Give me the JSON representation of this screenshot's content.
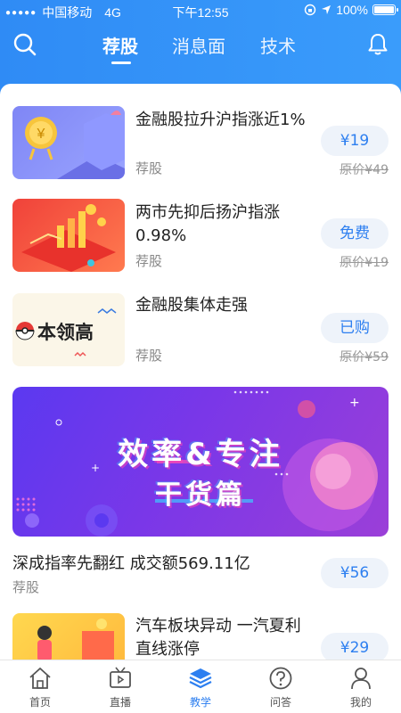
{
  "status_bar": {
    "carrier": "中国移动",
    "network": "4G",
    "time": "下午12:55",
    "battery": "100%"
  },
  "nav": {
    "tabs": [
      {
        "label": "荐股",
        "active": true
      },
      {
        "label": "消息面",
        "active": false
      },
      {
        "label": "技术",
        "active": false
      }
    ]
  },
  "articles": [
    {
      "title": "金融股拉升沪指涨近1%",
      "tag": "荐股",
      "price_label": "¥19",
      "original_price": "原价¥49"
    },
    {
      "title": "两市先抑后扬沪指涨0.98%",
      "tag": "荐股",
      "price_label": "免费",
      "original_price": "原价¥19"
    },
    {
      "title": "金融股集体走强",
      "tag": "荐股",
      "price_label": "已购",
      "original_price": "原价¥59",
      "thumb_text": "本领高"
    }
  ],
  "banner": {
    "line1": "效率&专注",
    "line2": "干货篇"
  },
  "featured_article": {
    "title": "深成指率先翻红 成交额569.11亿",
    "tag": "荐股",
    "price_label": "¥56"
  },
  "partial_article": {
    "title": "汽车板块异动 一汽夏利直线涨停",
    "price_label": "¥29"
  },
  "tabbar": [
    {
      "label": "首页",
      "icon": "home-icon",
      "active": false
    },
    {
      "label": "直播",
      "icon": "tv-icon",
      "active": false
    },
    {
      "label": "教学",
      "icon": "layers-icon",
      "active": true
    },
    {
      "label": "问答",
      "icon": "question-icon",
      "active": false
    },
    {
      "label": "我的",
      "icon": "user-icon",
      "active": false
    }
  ],
  "colors": {
    "header": "#3a9cfb",
    "accent": "#2d7ff0",
    "banner": "#7a37e8"
  }
}
